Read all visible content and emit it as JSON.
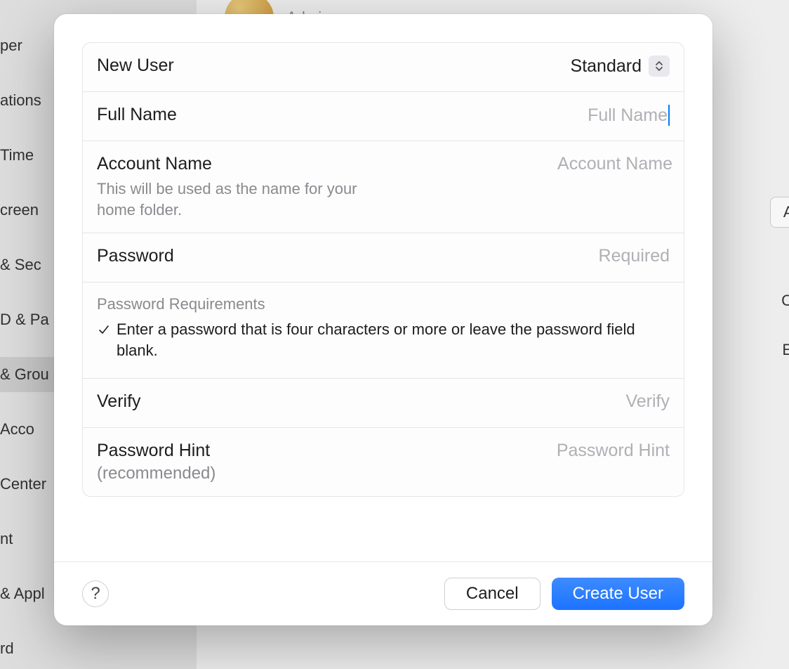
{
  "background": {
    "sidebar_items": [
      "per",
      "ations",
      "Time",
      "creen",
      " & Sec",
      "D & Pa",
      " & Grou",
      " Acco",
      "Center",
      "nt",
      " & Appl",
      "rd"
    ],
    "selected_index": 6,
    "admin_label": "Admin",
    "add_button": "Add",
    "right_c": "C",
    "right_e": "E"
  },
  "dialog": {
    "rows": {
      "new_user": {
        "label": "New User",
        "value": "Standard"
      },
      "full_name": {
        "label": "Full Name",
        "placeholder": "Full Name",
        "value": ""
      },
      "account_name": {
        "label": "Account Name",
        "sublabel": "This will be used as the name for your home folder.",
        "placeholder": "Account Name",
        "value": ""
      },
      "password": {
        "label": "Password",
        "placeholder": "Required",
        "value": ""
      },
      "requirements": {
        "title": "Password Requirements",
        "item": "Enter a password that is four characters or more or leave the password field blank."
      },
      "verify": {
        "label": "Verify",
        "placeholder": "Verify",
        "value": ""
      },
      "hint": {
        "label": "Password Hint",
        "recommended": "(recommended)",
        "placeholder": "Password Hint",
        "value": ""
      }
    },
    "footer": {
      "help": "?",
      "cancel": "Cancel",
      "create": "Create User"
    }
  }
}
